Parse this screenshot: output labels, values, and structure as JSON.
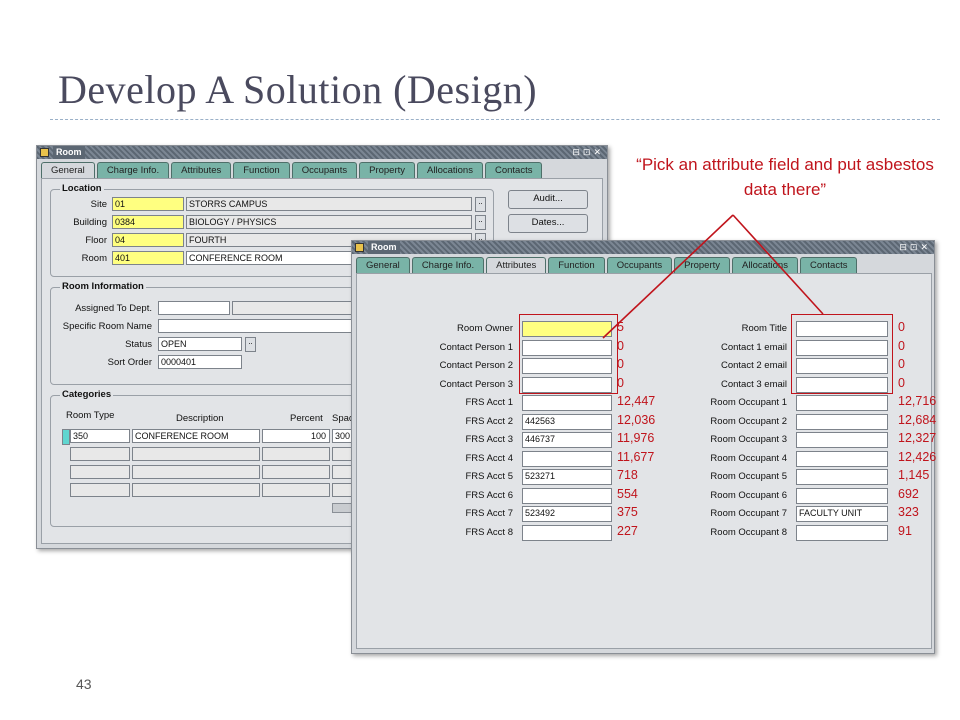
{
  "slide": {
    "title": "Develop A Solution (Design)",
    "number": "43",
    "callout": "“Pick an attribute field and put asbestos data there”"
  },
  "colors": {
    "callout": "#c0141c",
    "tab": "#79b3a7",
    "required": "#ffff80",
    "title": "#4a4a5e"
  },
  "back_window": {
    "title": "Room",
    "tabs": [
      "General",
      "Charge Info.",
      "Attributes",
      "Function",
      "Occupants",
      "Property",
      "Allocations",
      "Contacts"
    ],
    "location": {
      "label": "Location",
      "rows": [
        {
          "label": "Site",
          "code": "01",
          "desc": "STORRS CAMPUS"
        },
        {
          "label": "Building",
          "code": "0384",
          "desc": "BIOLOGY / PHYSICS"
        },
        {
          "label": "Floor",
          "code": "04",
          "desc": "FOURTH"
        },
        {
          "label": "Room",
          "code": "401",
          "desc": "CONFERENCE ROOM"
        }
      ]
    },
    "buttons": {
      "audit": "Audit...",
      "dates": "Dates..."
    },
    "room_information": {
      "label": "Room Information",
      "assigned_to_dept": "Assigned To Dept.",
      "specific_room_name": "Specific Room Name",
      "status_label": "Status",
      "status_value": "OPEN",
      "sort_order_label": "Sort Order",
      "sort_order_value": "0000401"
    },
    "categories": {
      "label": "Categories",
      "headers": [
        "Room Type",
        "Description",
        "Percent",
        "Spac"
      ],
      "row": {
        "room_type": "350",
        "description": "CONFERENCE ROOM",
        "percent": "100",
        "space": "300"
      }
    }
  },
  "front_window": {
    "title": "Room",
    "tabs": [
      "General",
      "Charge Info.",
      "Attributes",
      "Function",
      "Occupants",
      "Property",
      "Allocations",
      "Contacts"
    ],
    "active_tab": "Attributes",
    "left_fields": [
      {
        "label": "Room Owner",
        "value": "",
        "count": "5"
      },
      {
        "label": "Contact Person 1",
        "value": "",
        "count": "0"
      },
      {
        "label": "Contact Person 2",
        "value": "",
        "count": "0"
      },
      {
        "label": "Contact Person 3",
        "value": "",
        "count": "0"
      },
      {
        "label": "FRS Acct 1",
        "value": "",
        "count": "12,447"
      },
      {
        "label": "FRS Acct 2",
        "value": "442563",
        "count": "12,036"
      },
      {
        "label": "FRS Acct 3",
        "value": "446737",
        "count": "11,976"
      },
      {
        "label": "FRS Acct 4",
        "value": "",
        "count": "11,677"
      },
      {
        "label": "FRS Acct 5",
        "value": "523271",
        "count": "718"
      },
      {
        "label": "FRS Acct 6",
        "value": "",
        "count": "554"
      },
      {
        "label": "FRS Acct 7",
        "value": "523492",
        "count": "375"
      },
      {
        "label": "FRS Acct 8",
        "value": "",
        "count": "227"
      }
    ],
    "right_fields": [
      {
        "label": "Room Title",
        "value": "",
        "count": "0"
      },
      {
        "label": "Contact 1 email",
        "value": "",
        "count": "0"
      },
      {
        "label": "Contact 2 email",
        "value": "",
        "count": "0"
      },
      {
        "label": "Contact 3 email",
        "value": "",
        "count": "0"
      },
      {
        "label": "Room Occupant 1",
        "value": "",
        "count": "12,716"
      },
      {
        "label": "Room Occupant 2",
        "value": "",
        "count": "12,684"
      },
      {
        "label": "Room Occupant 3",
        "value": "",
        "count": "12,327"
      },
      {
        "label": "Room Occupant 4",
        "value": "",
        "count": "12,426"
      },
      {
        "label": "Room Occupant 5",
        "value": "",
        "count": "1,145"
      },
      {
        "label": "Room Occupant 6",
        "value": "",
        "count": "692"
      },
      {
        "label": "Room Occupant 7",
        "value": "FACULTY UNIT",
        "count": "323"
      },
      {
        "label": "Room Occupant 8",
        "value": "",
        "count": "91"
      }
    ]
  }
}
